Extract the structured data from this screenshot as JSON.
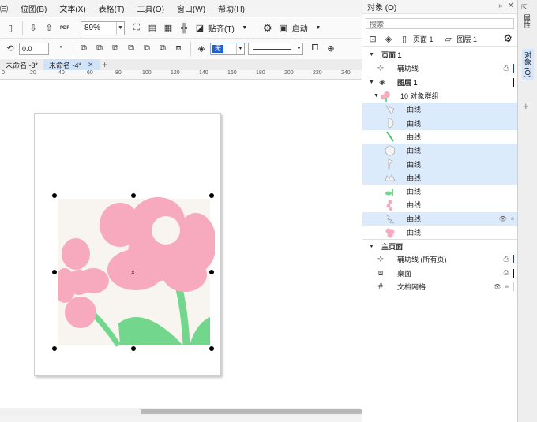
{
  "menu": [
    "㈢",
    "位图(B)",
    "文本(X)",
    "表格(T)",
    "工具(O)",
    "窗口(W)",
    "帮助(H)"
  ],
  "toolbar": {
    "zoom_value": "89%",
    "paste_label": "贴齐(T)",
    "launch_label": "启动",
    "pdf_label": "PDF"
  },
  "propbar": {
    "rotation_value": "0.0",
    "fill_value": "无"
  },
  "tabs": [
    {
      "label": "未命名 -3*",
      "active": false
    },
    {
      "label": "未命名 -4*",
      "active": true
    }
  ],
  "ruler_labels": [
    "0",
    "20",
    "40",
    "60",
    "80",
    "100",
    "120",
    "140",
    "160",
    "180",
    "200",
    "220",
    "240"
  ],
  "panel": {
    "title": "对象 (O)",
    "search_placeholder": "搜索",
    "page_label": "页面 1",
    "layer_label": "图层 1",
    "rows": [
      {
        "text": "页面 1",
        "bold": true,
        "kind": "page"
      },
      {
        "text": "辅助线",
        "kind": "guides",
        "bar": "#1437d6"
      },
      {
        "text": "图层 1",
        "bold": true,
        "kind": "layer",
        "bar": "#111111"
      },
      {
        "text": "10 对象群组",
        "kind": "group"
      },
      {
        "text": "曲线",
        "kind": "curve",
        "hl": true,
        "thumb": "leaf-outline"
      },
      {
        "text": "曲线",
        "kind": "curve",
        "hl": true,
        "thumb": "half-circle"
      },
      {
        "text": "曲线",
        "kind": "curve",
        "hl": false,
        "thumb": "green-stem"
      },
      {
        "text": "曲线",
        "kind": "curve",
        "hl": true,
        "thumb": "circle"
      },
      {
        "text": "曲线",
        "kind": "curve",
        "hl": true,
        "thumb": "flag"
      },
      {
        "text": "曲线",
        "kind": "curve",
        "hl": true,
        "thumb": "crown"
      },
      {
        "text": "曲线",
        "kind": "curve",
        "hl": false,
        "thumb": "green-leaves"
      },
      {
        "text": "曲线",
        "kind": "curve",
        "hl": false,
        "thumb": "pink-drops"
      },
      {
        "text": "曲线",
        "kind": "curve",
        "hl": true,
        "thumb": "scatter",
        "eye": true
      },
      {
        "text": "曲线",
        "kind": "curve",
        "hl": false,
        "thumb": "pink-flower"
      }
    ],
    "master_label": "主页面",
    "master_rows": [
      {
        "text": "辅助线 (所有页)",
        "kind": "guides",
        "bar": "#1437d6"
      },
      {
        "text": "桌面",
        "kind": "desktop",
        "bar": "#111111"
      },
      {
        "text": "文档网格",
        "kind": "grid"
      }
    ]
  },
  "dock_tabs": [
    "属性",
    "对象 (O)"
  ],
  "colors": {
    "flower_pink": "#f7a9bd",
    "stem_green": "#72d78c",
    "art_bg": "#f8f5f0",
    "active_tab": "#cfe3fb"
  }
}
